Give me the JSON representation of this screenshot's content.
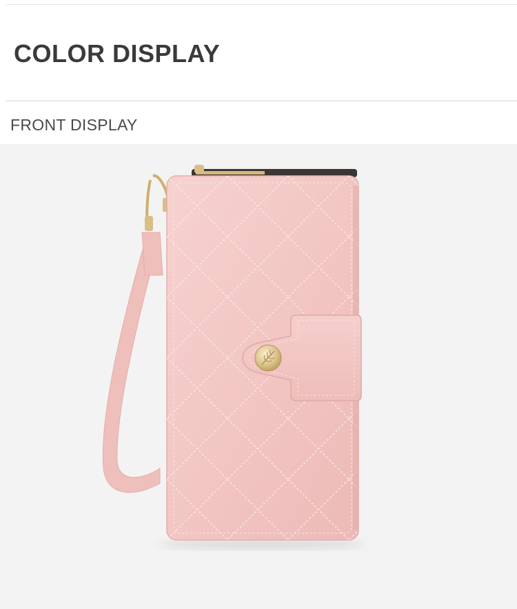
{
  "header": {
    "title": "COLOR DISPLAY"
  },
  "front_section": {
    "title": "FRONT DISPLAY"
  },
  "product_photo": {
    "subject": "pink quilted long wallet",
    "wallet_color": "#f2c7c4",
    "background_color": "#f3f3f3",
    "hardware_color": "#d9bf86"
  }
}
